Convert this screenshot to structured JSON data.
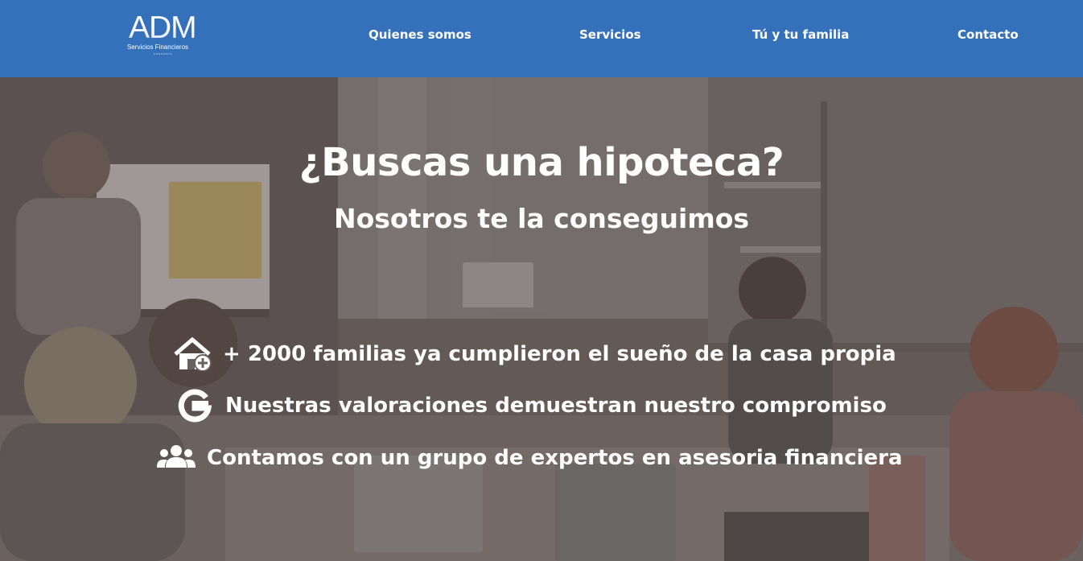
{
  "header": {
    "logo": {
      "mark": "ADM",
      "subtitle": "Servicios Financieros",
      "tagline": "ASESORIA"
    },
    "nav": [
      {
        "label": "Quienes somos"
      },
      {
        "label": "Servicios"
      },
      {
        "label": "Tú y tu familia"
      },
      {
        "label": "Contacto"
      }
    ]
  },
  "hero": {
    "title": "¿Buscas una hipoteca?",
    "subtitle": "Nosotros te la conseguimos",
    "features": [
      {
        "icon": "house-plus-icon",
        "text": "+ 2000 familias ya cumplieron el sueño de la casa propia"
      },
      {
        "icon": "google-icon",
        "text": "Nuestras valoraciones demuestran nuestro compromiso"
      },
      {
        "icon": "users-icon",
        "text": "Contamos con un grupo de expertos en asesoria financiera"
      }
    ]
  },
  "colors": {
    "header_bg": "#3471ba",
    "text": "#ffffff",
    "overlay": "#483e3e"
  }
}
